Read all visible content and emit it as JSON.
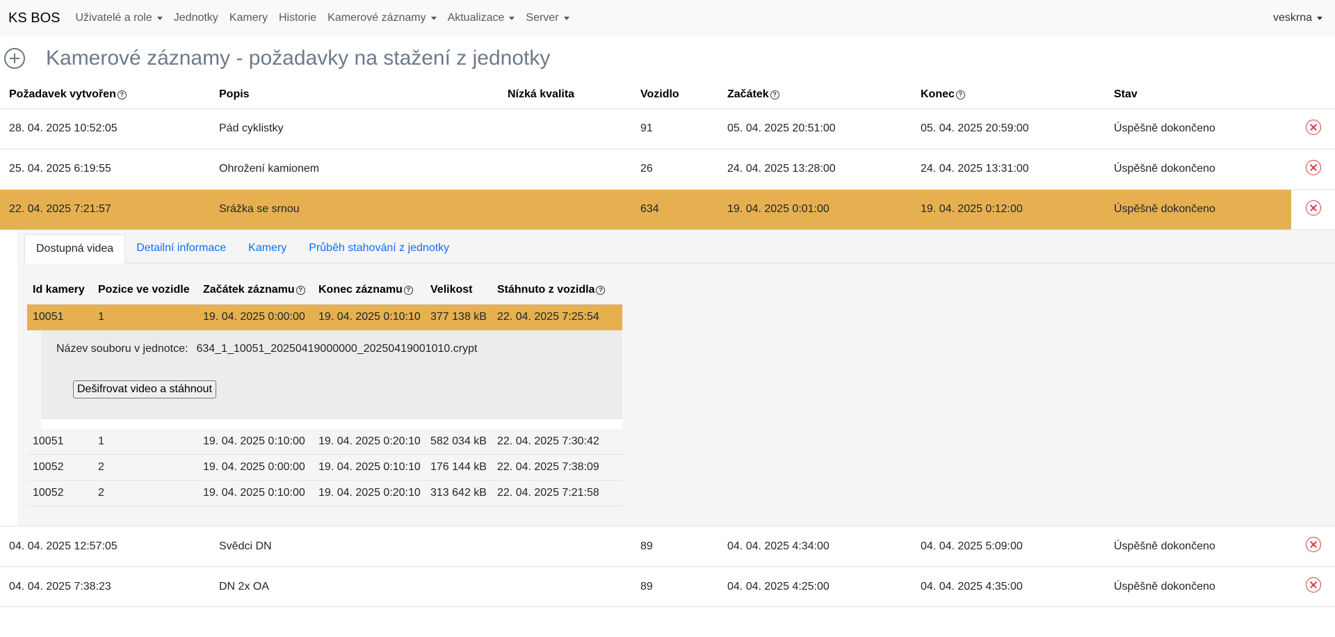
{
  "navbar": {
    "brand": "KS BOS",
    "items": [
      {
        "label": "Uživatelé a role",
        "dropdown": true
      },
      {
        "label": "Jednotky",
        "dropdown": false
      },
      {
        "label": "Kamery",
        "dropdown": false
      },
      {
        "label": "Historie",
        "dropdown": false
      },
      {
        "label": "Kamerové záznamy",
        "dropdown": true
      },
      {
        "label": "Aktualizace",
        "dropdown": true
      },
      {
        "label": "Server",
        "dropdown": true
      }
    ],
    "user": "veskrna"
  },
  "page": {
    "title": "Kamerové záznamy - požadavky na stažení z jednotky",
    "add_icon": "plus-circle-icon"
  },
  "table": {
    "headers": {
      "created": "Požadavek vytvořen",
      "description": "Popis",
      "low_quality": "Nízká kvalita",
      "vehicle": "Vozidlo",
      "start": "Začátek",
      "end": "Konec",
      "status": "Stav"
    },
    "rows": [
      {
        "created": "28. 04. 2025 10:52:05",
        "description": "Pád cyklistky",
        "low_quality": "",
        "vehicle": "91",
        "start": "05. 04. 2025 20:51:00",
        "end": "05. 04. 2025 20:59:00",
        "status": "Úspěšně dokončeno"
      },
      {
        "created": "25. 04. 2025 6:19:55",
        "description": "Ohrožení kamionem",
        "low_quality": "",
        "vehicle": "26",
        "start": "24. 04. 2025 13:28:00",
        "end": "24. 04. 2025 13:31:00",
        "status": "Úspěšně dokončeno"
      },
      {
        "created": "22. 04. 2025 7:21:57",
        "description": "Srážka se srnou",
        "low_quality": "",
        "vehicle": "634",
        "start": "19. 04. 2025 0:01:00",
        "end": "19. 04. 2025 0:12:00",
        "status": "Úspěšně dokončeno"
      },
      {
        "created": "04. 04. 2025 12:57:05",
        "description": "Svědci DN",
        "low_quality": "",
        "vehicle": "89",
        "start": "04. 04. 2025 4:34:00",
        "end": "04. 04. 2025 5:09:00",
        "status": "Úspěšně dokončeno"
      },
      {
        "created": "04. 04. 2025 7:38:23",
        "description": "DN 2x OA",
        "low_quality": "",
        "vehicle": "89",
        "start": "04. 04. 2025 4:25:00",
        "end": "04. 04. 2025 4:35:00",
        "status": "Úspěšně dokončeno"
      }
    ]
  },
  "detail": {
    "tabs": [
      "Dostupná videa",
      "Detailní informace",
      "Kamery",
      "Průběh stahování z jednotky"
    ],
    "active_tab": 0,
    "video_headers": {
      "camera_id": "Id kamery",
      "position": "Pozice ve vozidle",
      "rec_start": "Začátek záznamu",
      "rec_end": "Konec záznamu",
      "size": "Velikost",
      "downloaded": "Stáhnuto z vozidla"
    },
    "videos": [
      {
        "camera_id": "10051",
        "position": "1",
        "rec_start": "19. 04. 2025 0:00:00",
        "rec_end": "19. 04. 2025 0:10:10",
        "size": "377 138 kB",
        "downloaded": "22. 04. 2025 7:25:54"
      },
      {
        "camera_id": "10051",
        "position": "1",
        "rec_start": "19. 04. 2025 0:10:00",
        "rec_end": "19. 04. 2025 0:20:10",
        "size": "582 034 kB",
        "downloaded": "22. 04. 2025 7:30:42"
      },
      {
        "camera_id": "10052",
        "position": "2",
        "rec_start": "19. 04. 2025 0:00:00",
        "rec_end": "19. 04. 2025 0:10:10",
        "size": "176 144 kB",
        "downloaded": "22. 04. 2025 7:38:09"
      },
      {
        "camera_id": "10052",
        "position": "2",
        "rec_start": "19. 04. 2025 0:10:00",
        "rec_end": "19. 04. 2025 0:20:10",
        "size": "313 642 kB",
        "downloaded": "22. 04. 2025 7:21:58"
      }
    ],
    "file": {
      "label": "Název souboru v jednotce:",
      "name": "634_1_10051_20250419000000_20250419001010.crypt",
      "button": "Dešifrovat video a stáhnout"
    }
  },
  "colors": {
    "selected_row": "#e6b050",
    "link": "#0d6efd",
    "delete": "#dc3545"
  }
}
